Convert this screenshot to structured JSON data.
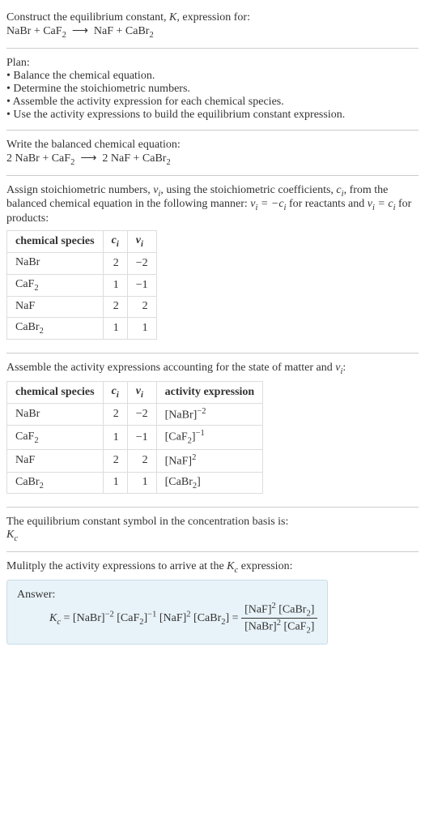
{
  "intro": {
    "line1a": "Construct the equilibrium constant, ",
    "line1b": ", expression for:",
    "K": "K",
    "eq_lhs": "NaBr + CaF",
    "eq_rhs": "NaF + CaBr",
    "sub2": "2",
    "arrow": "⟶"
  },
  "plan": {
    "heading": "Plan:",
    "b1": "• Balance the chemical equation.",
    "b2": "• Determine the stoichiometric numbers.",
    "b3": "• Assemble the activity expression for each chemical species.",
    "b4": "• Use the activity expressions to build the equilibrium constant expression."
  },
  "balanced": {
    "heading": "Write the balanced chemical equation:",
    "eq_lhs_a": "2 NaBr + CaF",
    "eq_rhs_a": "2 NaF + CaBr",
    "sub2": "2",
    "arrow": "⟶"
  },
  "stoich": {
    "text1": "Assign stoichiometric numbers, ",
    "nu_i": "ν",
    "sub_i": "i",
    "text2": ", using the stoichiometric coefficients, ",
    "c_i": "c",
    "text3": ", from the balanced chemical equation in the following manner: ",
    "eq_react_a": "ν",
    "eq_react_b": " = −c",
    "text4": " for reactants and ",
    "eq_prod_a": "ν",
    "eq_prod_b": " = c",
    "text5": " for products:"
  },
  "table1": {
    "h1": "chemical species",
    "h2": "c",
    "h3": "ν",
    "sub_i": "i",
    "rows": [
      {
        "sp_a": "NaBr",
        "sp_sub": "",
        "c": "2",
        "nu": "−2"
      },
      {
        "sp_a": "CaF",
        "sp_sub": "2",
        "c": "1",
        "nu": "−1"
      },
      {
        "sp_a": "NaF",
        "sp_sub": "",
        "c": "2",
        "nu": "2"
      },
      {
        "sp_a": "CaBr",
        "sp_sub": "2",
        "c": "1",
        "nu": "1"
      }
    ]
  },
  "activity_intro": {
    "text1": "Assemble the activity expressions accounting for the state of matter and ",
    "nu": "ν",
    "sub_i": "i",
    "text2": ":"
  },
  "table2": {
    "h1": "chemical species",
    "h2": "c",
    "h3": "ν",
    "h4": "activity expression",
    "sub_i": "i",
    "rows": [
      {
        "sp_a": "NaBr",
        "sp_sub": "",
        "c": "2",
        "nu": "−2",
        "act_a": "[NaBr]",
        "act_sub": "",
        "act_sup": "−2"
      },
      {
        "sp_a": "CaF",
        "sp_sub": "2",
        "c": "1",
        "nu": "−1",
        "act_a": "[CaF",
        "act_sub": "2",
        "act_a2": "]",
        "act_sup": "−1"
      },
      {
        "sp_a": "NaF",
        "sp_sub": "",
        "c": "2",
        "nu": "2",
        "act_a": "[NaF]",
        "act_sub": "",
        "act_sup": "2"
      },
      {
        "sp_a": "CaBr",
        "sp_sub": "2",
        "c": "1",
        "nu": "1",
        "act_a": "[CaBr",
        "act_sub": "2",
        "act_a2": "]",
        "act_sup": ""
      }
    ]
  },
  "kc_intro": {
    "text": "The equilibrium constant symbol in the concentration basis is:",
    "K": "K",
    "sub_c": "c"
  },
  "multiply": {
    "text1": "Mulitply the activity expressions to arrive at the ",
    "K": "K",
    "sub_c": "c",
    "text2": " expression:"
  },
  "answer": {
    "label": "Answer:",
    "K": "K",
    "sub_c": "c",
    "eq": " = ",
    "t1": "[NaBr]",
    "e1": "−2",
    "t2": " [CaF",
    "s2": "2",
    "t2b": "]",
    "e2": "−1",
    "t3": " [NaF]",
    "e3": "2",
    "t4": " [CaBr",
    "s4": "2",
    "t4b": "] = ",
    "num_a": "[NaF]",
    "num_e": "2",
    "num_b": " [CaBr",
    "num_s": "2",
    "num_c": "]",
    "den_a": "[NaBr]",
    "den_e": "2",
    "den_b": " [CaF",
    "den_s": "2",
    "den_c": "]"
  }
}
